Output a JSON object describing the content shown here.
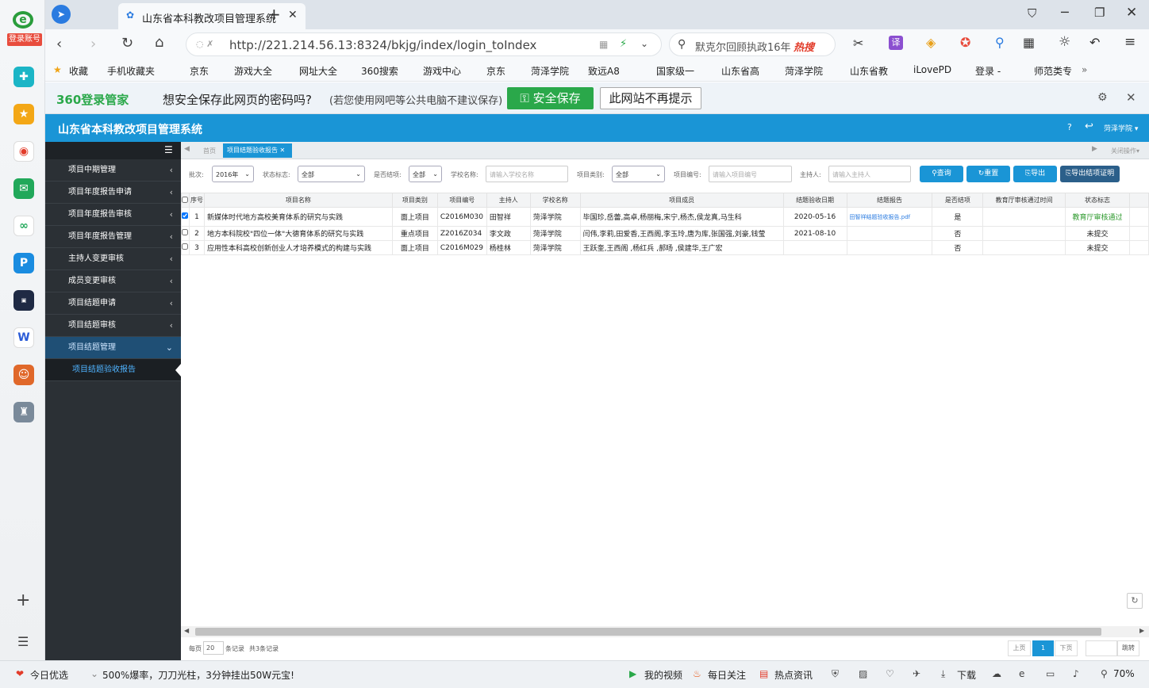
{
  "browser": {
    "login_label": "登录账号",
    "tab_title": "山东省本科教改项目管理系统",
    "url": "http://221.214.56.13:8324/bkjg/index/login_toIndex",
    "search_text": "默克尔回顾执政16年",
    "search_hot": "热搜",
    "bookmarks": [
      "收藏",
      "手机收藏夹",
      "京东",
      "游戏大全",
      "网址大全",
      "360搜索",
      "游戏中心",
      "京东",
      "菏泽学院",
      "致远A8",
      "国家级一",
      "山东省高",
      "菏泽学院",
      "山东省教",
      "iLovePD",
      "登录 -",
      "师范类专"
    ],
    "pw_brand": "360登录管家",
    "pw_question": "想安全保存此网页的密码吗?",
    "pw_note": "(若您使用网吧等公共电脑不建议保存)",
    "pw_save": "安全保存",
    "pw_never": "此网站不再提示"
  },
  "app": {
    "title": "山东省本科教改项目管理系统",
    "user": "菏泽学院",
    "sidebar": [
      "项目中期管理",
      "项目年度报告申请",
      "项目年度报告审核",
      "项目年度报告管理",
      "主持人变更审核",
      "成员变更审核",
      "项目结题申请",
      "项目结题审核",
      "项目结题管理"
    ],
    "sidebar_sub": "项目结题验收报告",
    "crumb_home": "首页",
    "crumb_active": "项目结题验收报告",
    "close_ops": "关闭操作",
    "filters": {
      "batch_label": "批次:",
      "batch_value": "2016年",
      "status_label": "状态标志:",
      "status_value": "全部",
      "concluded_label": "是否结项:",
      "concluded_value": "全部",
      "school_label": "学校名称:",
      "school_ph": "请输入学校名称",
      "type_label": "项目类别:",
      "type_value": "全部",
      "code_label": "项目编号:",
      "code_ph": "请输入项目编号",
      "host_label": "主持人:",
      "host_ph": "请输入主持人",
      "btn_query": "查询",
      "btn_reset": "重置",
      "btn_export": "导出",
      "btn_export_cert": "导出结项证明"
    },
    "columns": [
      "序号",
      "项目名称",
      "项目类别",
      "项目编号",
      "主持人",
      "学校名称",
      "项目成员",
      "结题验收日期",
      "结题报告",
      "是否结项",
      "教育厅审核通过时间",
      "状态标志"
    ],
    "rows": [
      {
        "no": "1",
        "name": "新媒体时代地方高校美育体系的研究与实践",
        "type": "面上项目",
        "code": "C2016M030",
        "host": "田智祥",
        "school": "菏泽学院",
        "members": "毕国珍,岳蕾,高卓,杨丽梅,宋宁,杨杰,侯龙真,马生科",
        "date": "2020-05-16",
        "report": "田智祥结题验收报告.pdf",
        "concluded": "是",
        "approved_time": "",
        "status": "教育厅审核通过",
        "checked": true
      },
      {
        "no": "2",
        "name": "地方本科院校\"四位一体\"大德育体系的研究与实践",
        "type": "重点项目",
        "code": "Z2016Z034",
        "host": "李文政",
        "school": "菏泽学院",
        "members": "闫伟,李莉,田爱香,王西阁,李玉玲,唐为库,张国强,刘豪,钱莹",
        "date": "2021-08-10",
        "report": "",
        "concluded": "否",
        "approved_time": "",
        "status": "未提交",
        "checked": false
      },
      {
        "no": "3",
        "name": "应用性本科高校创新创业人才培养模式的构建与实践",
        "type": "面上项目",
        "code": "C2016M029",
        "host": "杨桂林",
        "school": "菏泽学院",
        "members": "王跃奎,王西阁 ,杨红兵 ,郝旸 ,侯建华,王广宏",
        "date": "",
        "report": "",
        "concluded": "否",
        "approved_time": "",
        "status": "未提交",
        "checked": false
      }
    ],
    "pager": {
      "per_page_label": "每页",
      "per_page": "20",
      "unit": "条记录",
      "total": "共3条记录",
      "prev": "上页",
      "current": "1",
      "next": "下页",
      "jump": "跳转"
    }
  },
  "statusbar": {
    "promo_left": "今日优选",
    "ad": "500%爆率，刀刀光柱，3分钟挂出50W元宝!",
    "items": [
      "我的视频",
      "每日关注",
      "热点资讯",
      "下载"
    ],
    "zoom": "70%"
  },
  "colors": {
    "app_header": "#1a95d6",
    "sidebar": "#2b3035",
    "sidebar_active": "#1a95d6",
    "btn": "#1a95d6",
    "btn_dark": "#2b5f8a",
    "approved": "#2e9a2e",
    "save_green": "#2aa84a"
  }
}
